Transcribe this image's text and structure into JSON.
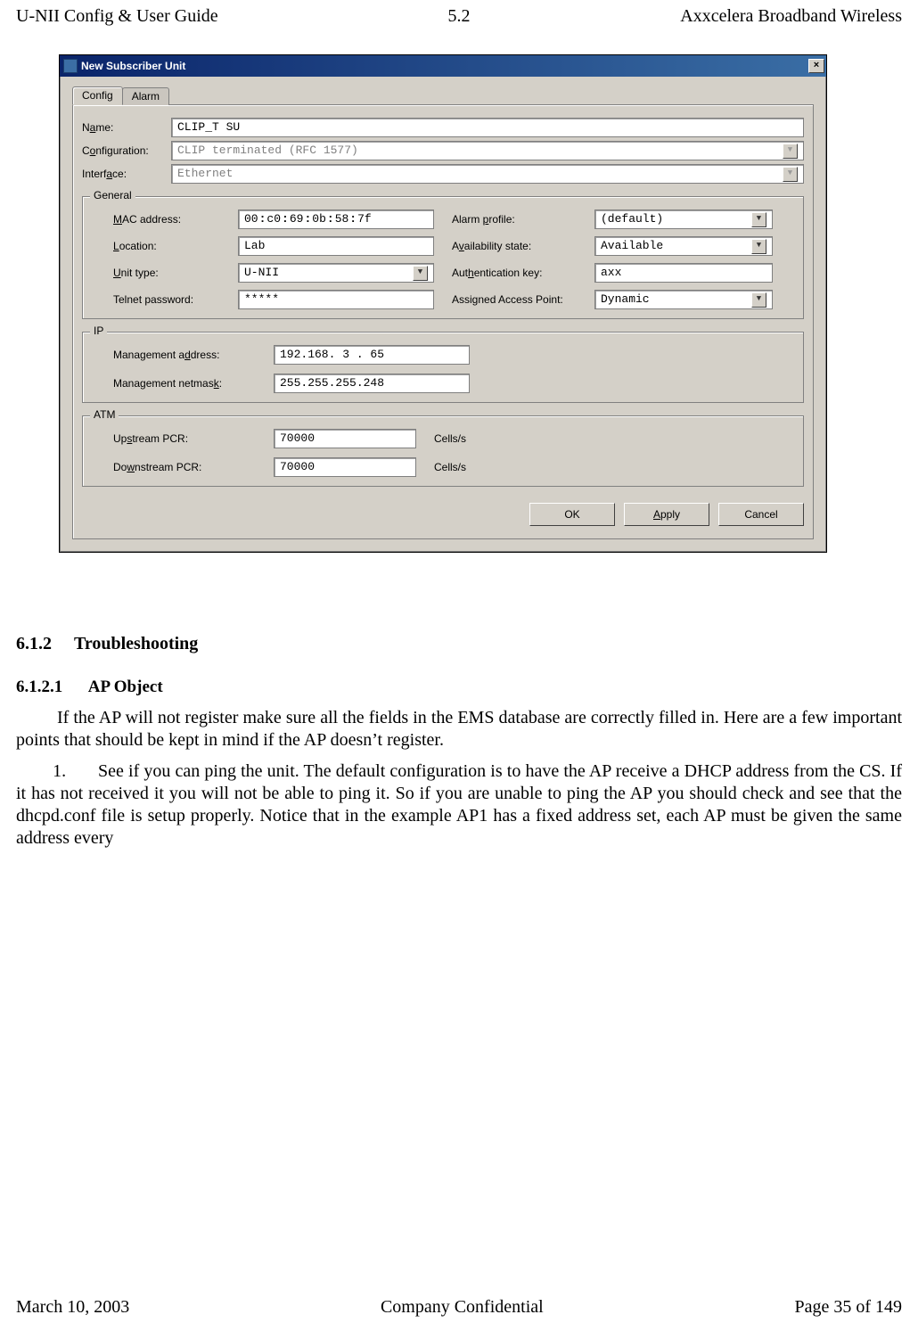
{
  "header": {
    "left": "U-NII Config & User Guide",
    "center": "5.2",
    "right": "Axxcelera Broadband Wireless"
  },
  "footer": {
    "left": "March 10, 2003",
    "center": "Company Confidential",
    "right": "Page 35 of 149"
  },
  "dialog": {
    "title": "New Subscriber Unit",
    "close_glyph": "×",
    "tabs": [
      {
        "label": "Config",
        "active": true
      },
      {
        "label": "Alarm",
        "active": false
      }
    ],
    "top_fields": {
      "name_label_pre": "N",
      "name_label_u": "a",
      "name_label_post": "me:",
      "name_value": "CLIP_T SU",
      "config_label_pre": "C",
      "config_label_u": "o",
      "config_label_post": "nfiguration:",
      "config_value": "CLIP terminated (RFC 1577)",
      "iface_label_pre": "Interf",
      "iface_label_u": "a",
      "iface_label_post": "ce:",
      "iface_value": "Ethernet"
    },
    "general": {
      "legend": "General",
      "mac_label_pre": "",
      "mac_label_u": "M",
      "mac_label_post": "AC address:",
      "mac_value": "00:c0:69:0b:58:7f",
      "loc_label_pre": "",
      "loc_label_u": "L",
      "loc_label_post": "ocation:",
      "loc_value": "Lab",
      "unit_label_pre": "",
      "unit_label_u": "U",
      "unit_label_post": "nit type:",
      "unit_value": "U-NII",
      "telnet_label": "Telnet password:",
      "telnet_value": "*****",
      "alarm_label_pre": "Alarm ",
      "alarm_label_u": "p",
      "alarm_label_post": "rofile:",
      "alarm_value": "(default)",
      "avail_label_pre": "A",
      "avail_label_u": "v",
      "avail_label_post": "ailability state:",
      "avail_value": "Available",
      "auth_label_pre": "Aut",
      "auth_label_u": "h",
      "auth_label_post": "entication key:",
      "auth_value": "axx",
      "ap_label": "Assigned Access Point:",
      "ap_value": "Dynamic"
    },
    "ip": {
      "legend": "IP",
      "mgmt_addr_label_pre": "Management a",
      "mgmt_addr_label_u": "d",
      "mgmt_addr_label_post": "dress:",
      "mgmt_addr_value": "192.168.  3 . 65",
      "mgmt_mask_label_pre": "Management netmas",
      "mgmt_mask_label_u": "k",
      "mgmt_mask_label_post": ":",
      "mgmt_mask_value": "255.255.255.248"
    },
    "atm": {
      "legend": "ATM",
      "up_label_pre": "Up",
      "up_label_u": "s",
      "up_label_post": "tream PCR:",
      "up_value": "70000",
      "down_label_pre": "Do",
      "down_label_u": "w",
      "down_label_post": "nstream PCR:",
      "down_value": "70000",
      "unit": "Cells/s"
    },
    "buttons": {
      "ok": "OK",
      "apply_pre": "",
      "apply_u": "A",
      "apply_post": "pply",
      "cancel": "Cancel"
    }
  },
  "body": {
    "h2_num": "6.1.2",
    "h2_text": "Troubleshooting",
    "h3_num": "6.1.2.1",
    "h3_text": "AP Object",
    "para1": "If the AP will not register make sure all the fields in the EMS database are correctly filled in. Here are a few important points that should be kept in mind if the AP doesn’t register.",
    "item1_num": "1.",
    "item1_text": "See if you can ping the unit. The default configuration is to have the AP receive a DHCP address from the CS. If it has not received it you will not be able to ping it. So if you are unable to ping the AP you should check and see that the dhcpd.conf file is setup properly. Notice that in the example AP1 has a fixed address set, each AP must be given the same address every"
  }
}
